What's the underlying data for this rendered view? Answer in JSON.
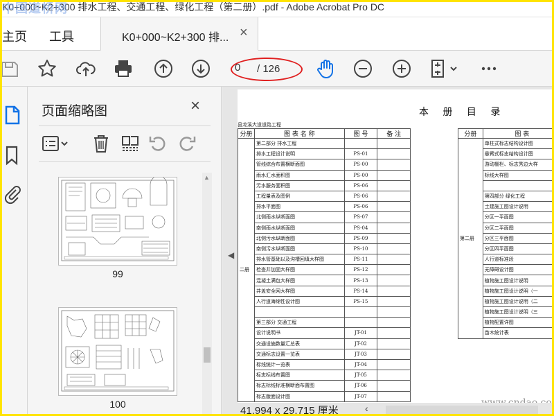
{
  "window": {
    "title": "K0+000~K2+300 排水工程、交通工程、绿化工程（第二册）.pdf - Adobe Acrobat Pro DC",
    "watermark": "中国道桥网"
  },
  "tabs": {
    "home": "主页",
    "tools": "工具",
    "document": "K0+000~K2+300 排...",
    "close": "×"
  },
  "toolbar": {
    "current_page": "0",
    "page_total": "/ 126",
    "icons": [
      "save-icon",
      "star-icon",
      "upload-icon",
      "print-icon",
      "page-up-icon",
      "page-down-icon",
      "hand-icon",
      "zoom-out-icon",
      "zoom-in-icon",
      "fit-page-icon",
      "more-icon"
    ],
    "annotation_color": "#e02020"
  },
  "thumbnails": {
    "title": "页面缩略图",
    "close": "×",
    "pages": [
      "99",
      "100"
    ]
  },
  "document": {
    "title": "本 册 目 录",
    "subtitle": "县龙溪大道道路工程",
    "columns": [
      "分册",
      "图 表 名 称",
      "图 号",
      "备 注"
    ],
    "volume": "二册",
    "rows": [
      {
        "name": "第二部分 排水工程",
        "code": ""
      },
      {
        "name": "排水工程设计说明",
        "code": "PS-01"
      },
      {
        "name": "管线综合布置横断面图",
        "code": "PS-00"
      },
      {
        "name": "雨水汇水面积图",
        "code": "PS-00"
      },
      {
        "name": "污水服务面积图",
        "code": "PS-06"
      },
      {
        "name": "工程量表及图例",
        "code": "PS-06"
      },
      {
        "name": "排水平面图",
        "code": "PS-06"
      },
      {
        "name": "北侧雨水纵断面图",
        "code": "PS-07"
      },
      {
        "name": "南侧雨水纵断面图",
        "code": "PS-04"
      },
      {
        "name": "北侧污水纵断面图",
        "code": "PS-09"
      },
      {
        "name": "南侧污水纵断面图",
        "code": "PS-10"
      },
      {
        "name": "排水管基础以及沟槽回填大样图",
        "code": "PS-11"
      },
      {
        "name": "检查井加固大样图",
        "code": "PS-12"
      },
      {
        "name": "混凝土满包大样图",
        "code": "PS-13"
      },
      {
        "name": "井盖安全网大样图",
        "code": "PS-14"
      },
      {
        "name": "人行道海绵性设计图",
        "code": "PS-15"
      },
      {
        "name": "",
        "code": ""
      },
      {
        "name": "第三部分 交通工程",
        "code": ""
      },
      {
        "name": "设计说明书",
        "code": "JT-01"
      },
      {
        "name": "交通设施数量汇总表",
        "code": "JT-02"
      },
      {
        "name": "交通标志设置一览表",
        "code": "JT-03"
      },
      {
        "name": "标线统计一览表",
        "code": "JT-04"
      },
      {
        "name": "标志标线布置图",
        "code": "JT-05"
      },
      {
        "name": "标志标线标准横断面布置图",
        "code": "JT-06"
      },
      {
        "name": "标志版面设计图",
        "code": "JT-07"
      }
    ],
    "columns2": [
      "分册",
      "图 表"
    ],
    "volume2": "第二册",
    "rows2": [
      "单柱式标志结构设计图",
      "悬臂式标志结构设计图",
      "游动栅栏、标志秀边大样",
      "标线大样图",
      "",
      "第四部分 绿化工程",
      "土建施工图设计说明",
      "分区一平面图",
      "分区二平面图",
      "分区三平面图",
      "分区四平面图",
      "人行道标准段",
      "无障碍设计图",
      "植物施工图设计说明",
      "植物施工图设计说明（一",
      "植物施工图设计说明（二",
      "植物施工图设计说明（三",
      "植物配置详图",
      "苗木统计表"
    ],
    "page_size": "41.994 x 29.715 厘米",
    "site_watermark": "www.cndao.com"
  }
}
